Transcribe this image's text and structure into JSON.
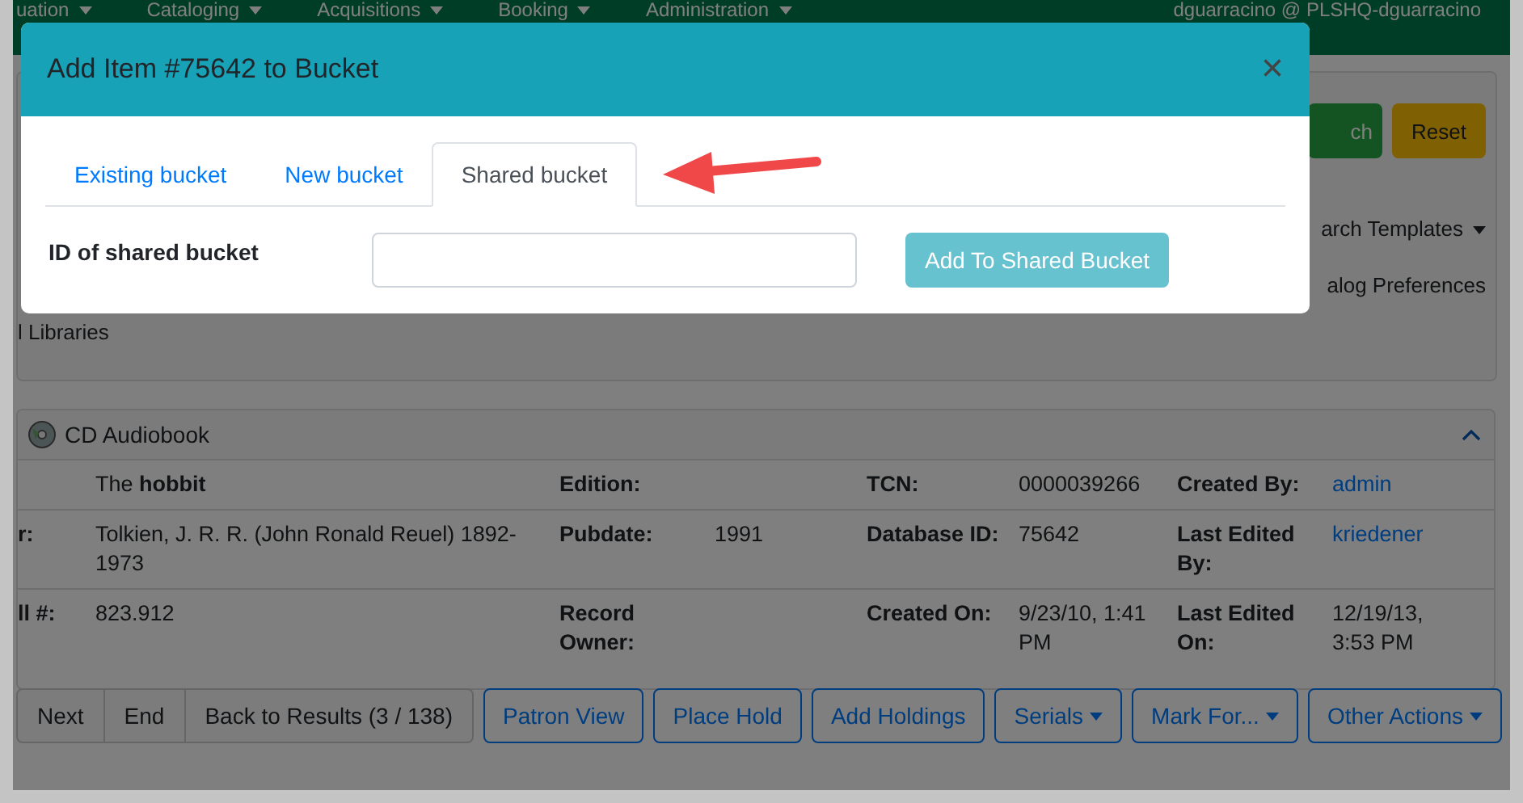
{
  "navbar": {
    "menus": [
      "uation",
      "Cataloging",
      "Acquisitions",
      "Booking",
      "Administration"
    ],
    "user": "dguarracino @ PLSHQ-dguarracino"
  },
  "search_panel": {
    "search_button": "ch",
    "reset_button": "Reset",
    "templates_menu": "arch Templates",
    "preferences_link": "alog Preferences",
    "libraries_text": "l Libraries"
  },
  "record": {
    "format": "CD Audiobook",
    "expanded": true,
    "rows": [
      {
        "cells": [
          {
            "value": "The **hobbit**",
            "kind": "text"
          },
          {
            "label": "Edition:"
          },
          {
            "label": "TCN:",
            "value": "0000039266",
            "kind": "text"
          },
          {
            "label": "Created By:",
            "value": "admin",
            "kind": "link"
          }
        ]
      },
      {
        "cells": [
          {
            "label": "r:",
            "value": "Tolkien, J. R. R. (John Ronald Reuel) 1892-1973",
            "kind": "text"
          },
          {
            "label": "Pubdate:",
            "value": "1991",
            "kind": "text"
          },
          {
            "label": "Database ID:",
            "value": "75642",
            "kind": "text"
          },
          {
            "label": "Last Edited By:",
            "value": "kriedener",
            "kind": "link"
          }
        ]
      },
      {
        "cells": [
          {
            "label": "ll #:",
            "value": "823.912",
            "kind": "text"
          },
          {
            "label": "Record Owner:"
          },
          {
            "label": "Created On:",
            "value": "9/23/10, 1:41 PM",
            "kind": "text"
          },
          {
            "label": "Last Edited On:",
            "value": "12/19/13, 3:53 PM",
            "kind": "text"
          }
        ]
      }
    ]
  },
  "nav_buttons": [
    "Next",
    "End",
    "Back to Results (3 / 138)"
  ],
  "action_buttons": [
    {
      "label": "Patron View",
      "kind": "button"
    },
    {
      "label": "Place Hold",
      "kind": "button"
    },
    {
      "label": "Add Holdings",
      "kind": "button"
    },
    {
      "label": "Serials",
      "kind": "dropdown"
    },
    {
      "label": "Mark For...",
      "kind": "dropdown"
    },
    {
      "label": "Other Actions",
      "kind": "dropdown"
    }
  ],
  "modal": {
    "title": "Add Item #75642 to Bucket",
    "close": "×",
    "tabs": [
      {
        "label": "Existing bucket",
        "selected": false
      },
      {
        "label": "New bucket",
        "selected": false
      },
      {
        "label": "Shared bucket",
        "selected": true
      }
    ],
    "field_label": "ID of shared bucket",
    "submit": {
      "label": "Add To Shared Bucket",
      "disabled": true
    }
  }
}
